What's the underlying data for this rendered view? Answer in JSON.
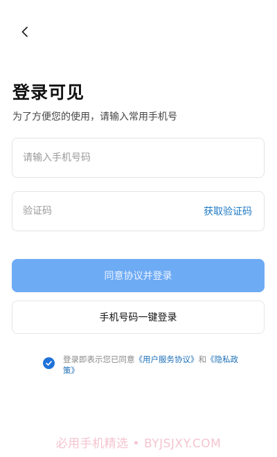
{
  "header": {
    "back_icon": "chevron-left-icon"
  },
  "title": "登录可见",
  "subtitle": "为了方便您的使用，请输入常用手机号",
  "phone_field": {
    "placeholder": "请输入手机号码",
    "value": ""
  },
  "code_field": {
    "placeholder": "验证码",
    "value": "",
    "get_code_label": "获取验证码"
  },
  "primary_button": {
    "label": "同意协议并登录",
    "color": "#6eabf5"
  },
  "secondary_button": {
    "label": "手机号码一键登录"
  },
  "agreement": {
    "checked": true,
    "prefix": "登录即表示您已同意",
    "user_agreement": "《用户服务协议》",
    "conjunction": "和",
    "privacy_policy": "《隐私政策》"
  },
  "watermark": "必用手机精选 • BYJSJXY.COM",
  "colors": {
    "accent": "#1f72d8",
    "link": "#1d79c4"
  }
}
